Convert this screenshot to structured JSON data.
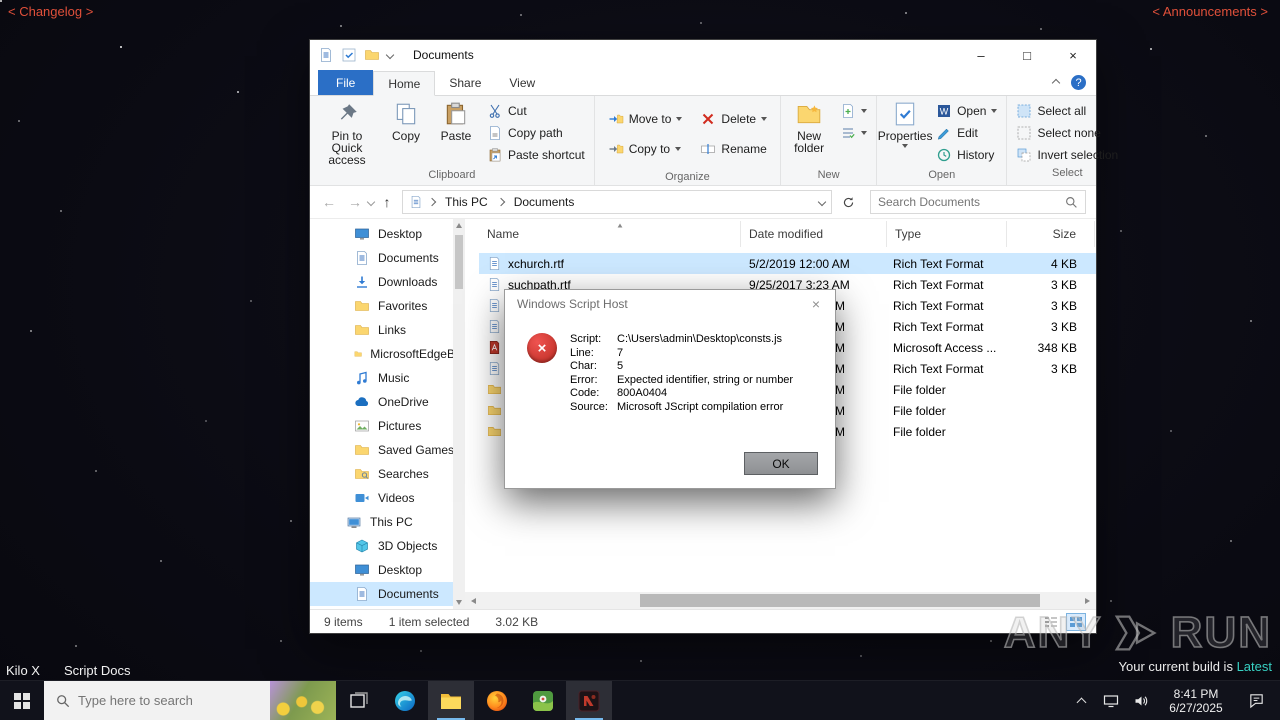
{
  "colors": {
    "accent_blue": "#2b6fc6",
    "selection_blue": "#cce8ff",
    "error_red": "#b92b21",
    "banner_red": "#e0503a",
    "latest_teal": "#38d1c3"
  },
  "icons": {
    "minimize": "–",
    "maximize": "□",
    "close": "×",
    "back": "←",
    "forward": "→",
    "up": "↑",
    "help": "?",
    "dialog_close": "×",
    "error_glyph": "×"
  },
  "desktop": {
    "changelog_link": "< Changelog >",
    "announcements_link": "< Announcements >",
    "shortcut_labels": [
      "Kilo X",
      "Script Docs"
    ]
  },
  "watermark": {
    "brand_left": "ANY",
    "brand_right": "RUN",
    "build_prefix": "Your current build is",
    "build_value": "Latest"
  },
  "taskbar": {
    "search_placeholder": "Type here to search",
    "time": "8:41 PM",
    "date": "6/27/2025"
  },
  "explorer": {
    "title": "Documents",
    "tabs": {
      "file": "File",
      "home": "Home",
      "share": "Share",
      "view": "View"
    },
    "ribbon": {
      "pin": "Pin to Quick access",
      "copy": "Copy",
      "paste": "Paste",
      "cut": "Cut",
      "copy_path": "Copy path",
      "paste_shortcut": "Paste shortcut",
      "clipboard_label": "Clipboard",
      "move_to": "Move to",
      "copy_to": "Copy to",
      "delete": "Delete",
      "rename": "Rename",
      "organize_label": "Organize",
      "new_folder": "New folder",
      "new_label": "New",
      "properties": "Properties",
      "open": "Open",
      "edit": "Edit",
      "history": "History",
      "open_label": "Open",
      "select_all": "Select all",
      "select_none": "Select none",
      "invert_selection": "Invert selection",
      "select_label": "Select"
    },
    "address": {
      "crumbs": [
        "This PC",
        "Documents"
      ]
    },
    "search_placeholder": "Search Documents",
    "nav": {
      "items": [
        "Desktop",
        "Documents",
        "Downloads",
        "Favorites",
        "Links",
        "MicrosoftEdgeB...",
        "Music",
        "OneDrive",
        "Pictures",
        "Saved Games",
        "Searches",
        "Videos",
        "This PC",
        "3D Objects",
        "Desktop",
        "Documents"
      ]
    },
    "files": {
      "columns": [
        "Name",
        "Date modified",
        "Type",
        "Size"
      ],
      "rows": [
        {
          "name": "xchurch.rtf",
          "date": "5/2/2019 12:00 AM",
          "type": "Rich Text Format",
          "size": "4 KB"
        },
        {
          "name": "suchpath.rtf",
          "date": "9/25/2017 3:23 AM",
          "type": "Rich Text Format",
          "size": "3 KB"
        },
        {
          "name": "",
          "date": "M",
          "type": "Rich Text Format",
          "size": "3 KB"
        },
        {
          "name": "",
          "date": "M",
          "type": "Rich Text Format",
          "size": "3 KB"
        },
        {
          "name": "",
          "date": "AM",
          "type": "Microsoft Access ...",
          "size": "348 KB"
        },
        {
          "name": "",
          "date": "M",
          "type": "Rich Text Format",
          "size": "3 KB"
        },
        {
          "name": "",
          "date": "M",
          "type": "File folder",
          "size": ""
        },
        {
          "name": "",
          "date": "AM",
          "type": "File folder",
          "size": ""
        },
        {
          "name": "",
          "date": "M",
          "type": "File folder",
          "size": ""
        }
      ]
    },
    "status": {
      "items": "9 items",
      "selected": "1 item selected",
      "size": "3.02 KB"
    }
  },
  "dialog": {
    "title": "Windows Script Host",
    "fields": [
      {
        "label": "Script:",
        "value": "C:\\Users\\admin\\Desktop\\consts.js"
      },
      {
        "label": "Line:",
        "value": "7"
      },
      {
        "label": "Char:",
        "value": "5"
      },
      {
        "label": "Error:",
        "value": "Expected identifier, string or number"
      },
      {
        "label": "Code:",
        "value": "800A0404"
      },
      {
        "label": "Source:",
        "value": "Microsoft JScript compilation error"
      }
    ],
    "ok_label": "OK"
  }
}
